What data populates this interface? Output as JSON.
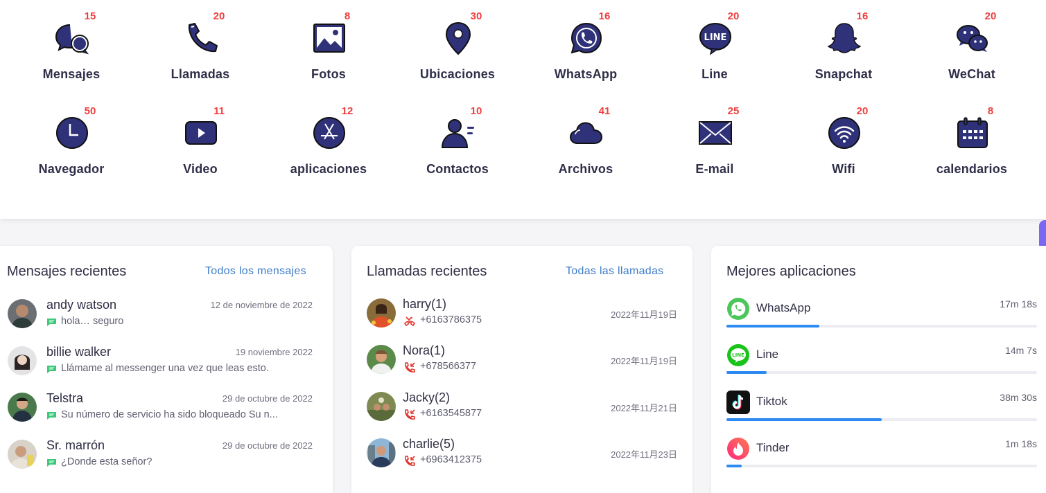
{
  "features": [
    {
      "label": "Mensajes",
      "count": "15",
      "icon": "chat-bubbles-icon"
    },
    {
      "label": "Llamadas",
      "count": "20",
      "icon": "phone-icon"
    },
    {
      "label": "Fotos",
      "count": "8",
      "icon": "photo-icon"
    },
    {
      "label": "Ubicaciones",
      "count": "30",
      "icon": "location-pin-icon"
    },
    {
      "label": "WhatsApp",
      "count": "16",
      "icon": "whatsapp-icon"
    },
    {
      "label": "Line",
      "count": "20",
      "icon": "line-icon"
    },
    {
      "label": "Snapchat",
      "count": "16",
      "icon": "snapchat-icon"
    },
    {
      "label": "WeChat",
      "count": "20",
      "icon": "wechat-icon"
    },
    {
      "label": "Navegador",
      "count": "50",
      "icon": "clock-icon"
    },
    {
      "label": "Video",
      "count": "11",
      "icon": "video-play-icon"
    },
    {
      "label": "aplicaciones",
      "count": "12",
      "icon": "app-store-icon"
    },
    {
      "label": "Contactos",
      "count": "10",
      "icon": "contact-person-icon"
    },
    {
      "label": "Archivos",
      "count": "41",
      "icon": "cloud-icon"
    },
    {
      "label": "E-mail",
      "count": "25",
      "icon": "envelope-icon"
    },
    {
      "label": "Wifi",
      "count": "20",
      "icon": "wifi-icon"
    },
    {
      "label": "calendarios",
      "count": "8",
      "icon": "calendar-icon"
    }
  ],
  "messages": {
    "title": "Mensajes recientes",
    "link": "Todos los mensajes",
    "items": [
      {
        "name": "andy watson",
        "date": "12 de noviembre de 2022",
        "text": "hola… seguro"
      },
      {
        "name": "billie walker",
        "date": "19 noviembre 2022",
        "text": "Llámame al messenger una vez que leas esto."
      },
      {
        "name": "Telstra",
        "date": "29 de octubre de 2022",
        "text": "Su número de servicio ha sido bloqueado Su n..."
      },
      {
        "name": "Sr. marrón",
        "date": "29 de octubre de 2022",
        "text": "¿Donde esta señor?"
      }
    ]
  },
  "calls": {
    "title": "Llamadas recientes",
    "link": "Todas las llamadas",
    "items": [
      {
        "name": "harry(1)",
        "number": "+6163786375",
        "date": "2022年11月19日",
        "type": "missed"
      },
      {
        "name": "Nora(1)",
        "number": "+678566377",
        "date": "2022年11月19日",
        "type": "incoming"
      },
      {
        "name": "Jacky(2)",
        "number": "+6163545877",
        "date": "2022年11月21日",
        "type": "incoming"
      },
      {
        "name": "charlie(5)",
        "number": "+6963412375",
        "date": "2022年11月23日",
        "type": "incoming"
      }
    ]
  },
  "apps": {
    "title": "Mejores aplicaciones",
    "items": [
      {
        "name": "WhatsApp",
        "time": "17m 18s",
        "share": 0.3,
        "icon": "whatsapp-logo-icon"
      },
      {
        "name": "Line",
        "time": "14m 7s",
        "share": 0.13,
        "icon": "line-logo-icon"
      },
      {
        "name": "Tiktok",
        "time": "38m 30s",
        "share": 0.5,
        "icon": "tiktok-logo-icon"
      },
      {
        "name": "Tinder",
        "time": "1m 18s",
        "share": 0.05,
        "icon": "tinder-logo-icon"
      }
    ]
  },
  "colors": {
    "accent": "#2c8af2",
    "badge": "#ef3e3e",
    "icon_fill": "#2f3278",
    "link": "#3d7cc9",
    "side_tab": "#7a67f2"
  }
}
